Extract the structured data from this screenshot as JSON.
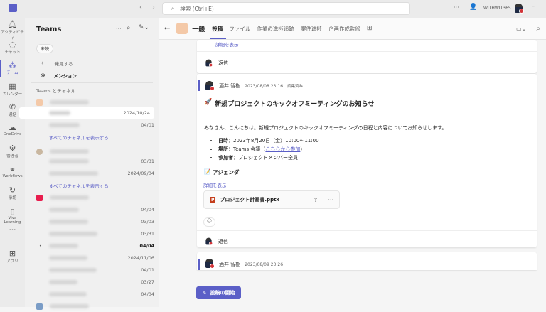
{
  "titlebar": {
    "search_placeholder": "検索 (Ctrl+E)",
    "org": "WITHWIT365"
  },
  "rail": [
    {
      "label": "アクティビティ",
      "icon": "bell-icon"
    },
    {
      "label": "チャット",
      "icon": "chat-icon"
    },
    {
      "label": "チーム",
      "icon": "teams-icon"
    },
    {
      "label": "カレンダー",
      "icon": "calendar-icon"
    },
    {
      "label": "通話",
      "icon": "phone-icon"
    },
    {
      "label": "OneDrive",
      "icon": "cloud-icon"
    },
    {
      "label": "管理者",
      "icon": "admin-icon"
    },
    {
      "label": "Workflows",
      "icon": "workflows-icon"
    },
    {
      "label": "承認",
      "icon": "approvals-icon"
    },
    {
      "label": "Viva Learning",
      "icon": "learning-icon"
    },
    {
      "label": "•••",
      "icon": "more-icon"
    },
    {
      "label": "アプリ",
      "icon": "apps-icon"
    }
  ],
  "sidebar": {
    "title": "Teams",
    "filter": "未読",
    "discover": "発見する",
    "mentions": "メンション",
    "section": "Teams とチャネル",
    "show_all": "すべてのチャネルを表示する",
    "dates": [
      "2024/10/24",
      "04/01",
      "03/31",
      "2024/09/04",
      "04/04",
      "03/03",
      "03/31",
      "04/04",
      "2024/11/06",
      "04/01",
      "03/27",
      "04/04"
    ]
  },
  "channel": {
    "name": "一般",
    "tabs": [
      "投稿",
      "ファイル",
      "作業の進捗追跡",
      "案件進捗",
      "企画作成監修"
    ]
  },
  "posts": {
    "show_more": "詳細を表示",
    "reply": "返信",
    "author": "酒井 智樹",
    "time1": "2023/08/08 23:16",
    "edited": "編集済み",
    "title": "新規プロジェクトのキックオフミーティングのお知らせ",
    "intro": "みなさん、こんにちは。新規プロジェクトのキックオフミーティングの日程と内容についてお知らせします。",
    "b1_label": "日時",
    "b1_value": "：2023年8月20日（金）10:00～11:00",
    "b2_label": "場所",
    "b2_value": "：Teams 会議（",
    "b2_link": "こちらから参加",
    "b2_end": "）",
    "b3_label": "参加者",
    "b3_value": "：プロジェクトメンバー全員",
    "agenda": "アジェンダ",
    "file": "プロジェクト計画書.pptx",
    "time2": "2023/08/09 23:26"
  },
  "new_post": "投稿の開始"
}
